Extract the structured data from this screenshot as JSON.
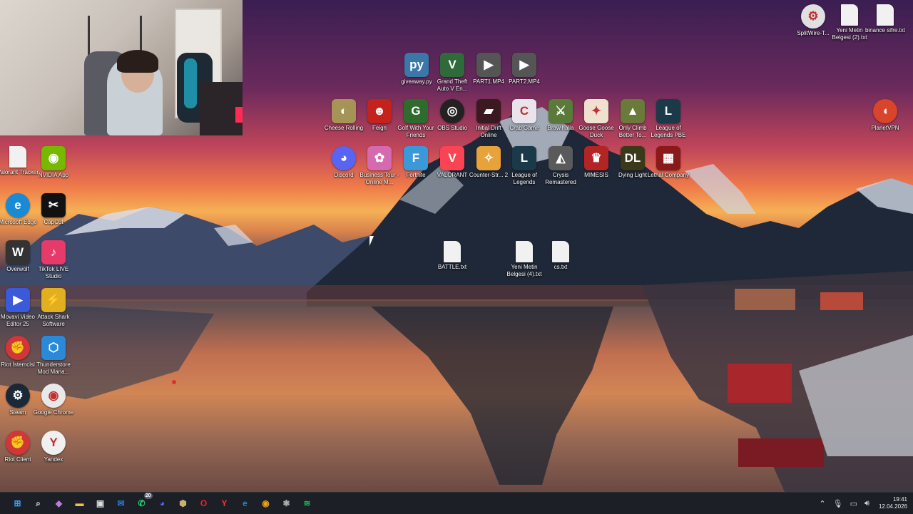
{
  "desktop": {
    "icons": [
      {
        "label": "giveaway.py",
        "icon": "python-file-icon",
        "color": "#3b77a8"
      },
      {
        "label": "Grand Theft Auto V En...",
        "icon": "gta-icon",
        "color": "#2f6a3a"
      },
      {
        "label": "PART1.MP4",
        "icon": "video-file-icon",
        "color": "#555"
      },
      {
        "label": "PART2.MP4",
        "icon": "video-file-icon",
        "color": "#555"
      },
      {
        "label": "Cheese Rolling",
        "icon": "cheese-rolling-icon",
        "color": "#a59456"
      },
      {
        "label": "Feign",
        "icon": "feign-icon",
        "color": "#c4221c"
      },
      {
        "label": "Golf With Your Friends",
        "icon": "golf-icon",
        "color": "#2f6b2c"
      },
      {
        "label": "OBS Studio",
        "icon": "obs-icon",
        "color": "#222"
      },
      {
        "label": "Initial Drift Online",
        "icon": "drift-icon",
        "color": "#3a1a20"
      },
      {
        "label": "Crab Game",
        "icon": "crab-game-icon",
        "color": "#e9e4ec"
      },
      {
        "label": "Brawlhalla",
        "icon": "brawlhalla-icon",
        "color": "#5a7a3a"
      },
      {
        "label": "Goose Goose Duck",
        "icon": "goose-icon",
        "color": "#f0e0d0"
      },
      {
        "label": "Only Climb Better To...",
        "icon": "only-climb-icon",
        "color": "#6a7a3a"
      },
      {
        "label": "League of Legends PBE",
        "icon": "league-pbe-icon",
        "color": "#1a3a4a"
      },
      {
        "label": "Discord",
        "icon": "discord-icon",
        "color": "#5865f2"
      },
      {
        "label": "Business Tour - Online M...",
        "icon": "business-tour-icon",
        "color": "#d66ab0"
      },
      {
        "label": "Fortnite",
        "icon": "fortnite-icon",
        "color": "#3a9ad9"
      },
      {
        "label": "VALORANT",
        "icon": "valorant-icon",
        "color": "#fa4454"
      },
      {
        "label": "Counter-Str... 2",
        "icon": "cs2-icon",
        "color": "#e8a23a"
      },
      {
        "label": "League of Legends",
        "icon": "league-icon",
        "color": "#1a3a4a"
      },
      {
        "label": "Crysis Remastered",
        "icon": "crysis-icon",
        "color": "#5a5a5a"
      },
      {
        "label": "MIMESIS",
        "icon": "mimesis-icon",
        "color": "#b32424"
      },
      {
        "label": "Dying Light",
        "icon": "dying-light-icon",
        "color": "#3a3a1a"
      },
      {
        "label": "Lethal Company",
        "icon": "lethal-company-icon",
        "color": "#8a1a1a"
      },
      {
        "label": "BATTLE.txt",
        "icon": "text-file-icon",
        "color": "#f1f1f1"
      },
      {
        "label": "Yeni Metin Belgesi (4).txt",
        "icon": "text-file-icon",
        "color": "#f1f1f1"
      },
      {
        "label": "cs.txt",
        "icon": "text-file-icon",
        "color": "#f1f1f1"
      },
      {
        "label": "SplitWire-T...",
        "icon": "splitwire-icon",
        "color": "#e0e0e0"
      },
      {
        "label": "Yeni Metin Belgesi (2).txt",
        "icon": "text-file-icon",
        "color": "#f1f1f1"
      },
      {
        "label": "binance sifre.txt",
        "icon": "text-file-icon",
        "color": "#f1f1f1"
      },
      {
        "label": "PlanetVPN",
        "icon": "planetvpn-icon",
        "color": "#d8452a"
      },
      {
        "label": "Valorant Tracker",
        "icon": "text-file-icon",
        "color": "#f1f1f1"
      },
      {
        "label": "NVIDIA App",
        "icon": "nvidia-icon",
        "color": "#76b900"
      },
      {
        "label": "Microsoft Edge",
        "icon": "edge-icon",
        "color": "#1a8ad4"
      },
      {
        "label": "CapCut",
        "icon": "capcut-icon",
        "color": "#111"
      },
      {
        "label": "Overwolf",
        "icon": "overwolf-icon",
        "color": "#333"
      },
      {
        "label": "TikTok LIVE Studio",
        "icon": "tiktok-icon",
        "color": "#e63a6a"
      },
      {
        "label": "Movavi Video Editor 25",
        "icon": "movavi-icon",
        "color": "#3a5ad9"
      },
      {
        "label": "Attack Shark Software",
        "icon": "attack-shark-icon",
        "color": "#e0b020"
      },
      {
        "label": "Riot İstemcisi",
        "icon": "riot-icon",
        "color": "#d13639"
      },
      {
        "label": "Thunderstore Mod Mana...",
        "icon": "thunderstore-icon",
        "color": "#2a8ad9"
      },
      {
        "label": "Steam",
        "icon": "steam-icon",
        "color": "#1b2838"
      },
      {
        "label": "Google Chrome",
        "icon": "chrome-icon",
        "color": "#e8e8e8"
      },
      {
        "label": "Riot Client",
        "icon": "riot-icon",
        "color": "#d13639"
      },
      {
        "label": "Yandex",
        "icon": "yandex-icon",
        "color": "#f0f0f0"
      }
    ]
  },
  "taskbar": {
    "apps": [
      {
        "name": "start-button",
        "icon": "windows-icon",
        "glyph": "⊞",
        "color": "#3aa0ff"
      },
      {
        "name": "taskbar-search",
        "icon": "search-icon",
        "glyph": "⌕",
        "color": "#ddd"
      },
      {
        "name": "taskbar-copilot",
        "icon": "copilot-icon",
        "glyph": "◆",
        "color": "#c07ad9"
      },
      {
        "name": "taskbar-file-explorer",
        "icon": "folder-icon",
        "glyph": "▬",
        "color": "#f0c040"
      },
      {
        "name": "taskbar-store",
        "icon": "store-icon",
        "glyph": "▣",
        "color": "#dddddd"
      },
      {
        "name": "taskbar-mail",
        "icon": "mail-icon",
        "glyph": "✉",
        "color": "#2a7ad9"
      },
      {
        "name": "taskbar-whatsapp",
        "icon": "whatsapp-icon",
        "glyph": "✆",
        "color": "#25d366",
        "badge": "20"
      },
      {
        "name": "taskbar-discord",
        "icon": "discord-icon",
        "glyph": "◕",
        "color": "#5865f2"
      },
      {
        "name": "taskbar-app-shield",
        "icon": "shield-icon",
        "glyph": "⬢",
        "color": "#c9b070"
      },
      {
        "name": "taskbar-opera",
        "icon": "opera-icon",
        "glyph": "O",
        "color": "#ff1b2d"
      },
      {
        "name": "taskbar-yandex",
        "icon": "yandex-icon",
        "glyph": "Y",
        "color": "#ff3333"
      },
      {
        "name": "taskbar-edge",
        "icon": "edge-icon",
        "glyph": "e",
        "color": "#1a8ad4"
      },
      {
        "name": "taskbar-chrome",
        "icon": "chrome-icon",
        "glyph": "◉",
        "color": "#e8a020"
      },
      {
        "name": "taskbar-riot",
        "icon": "riot-icon",
        "glyph": "✱",
        "color": "#aaaaaa"
      },
      {
        "name": "taskbar-spotify",
        "icon": "spotify-icon",
        "glyph": "≋",
        "color": "#1db954"
      }
    ],
    "clock": {
      "time": "19:41",
      "date": "12.04.2026"
    }
  }
}
